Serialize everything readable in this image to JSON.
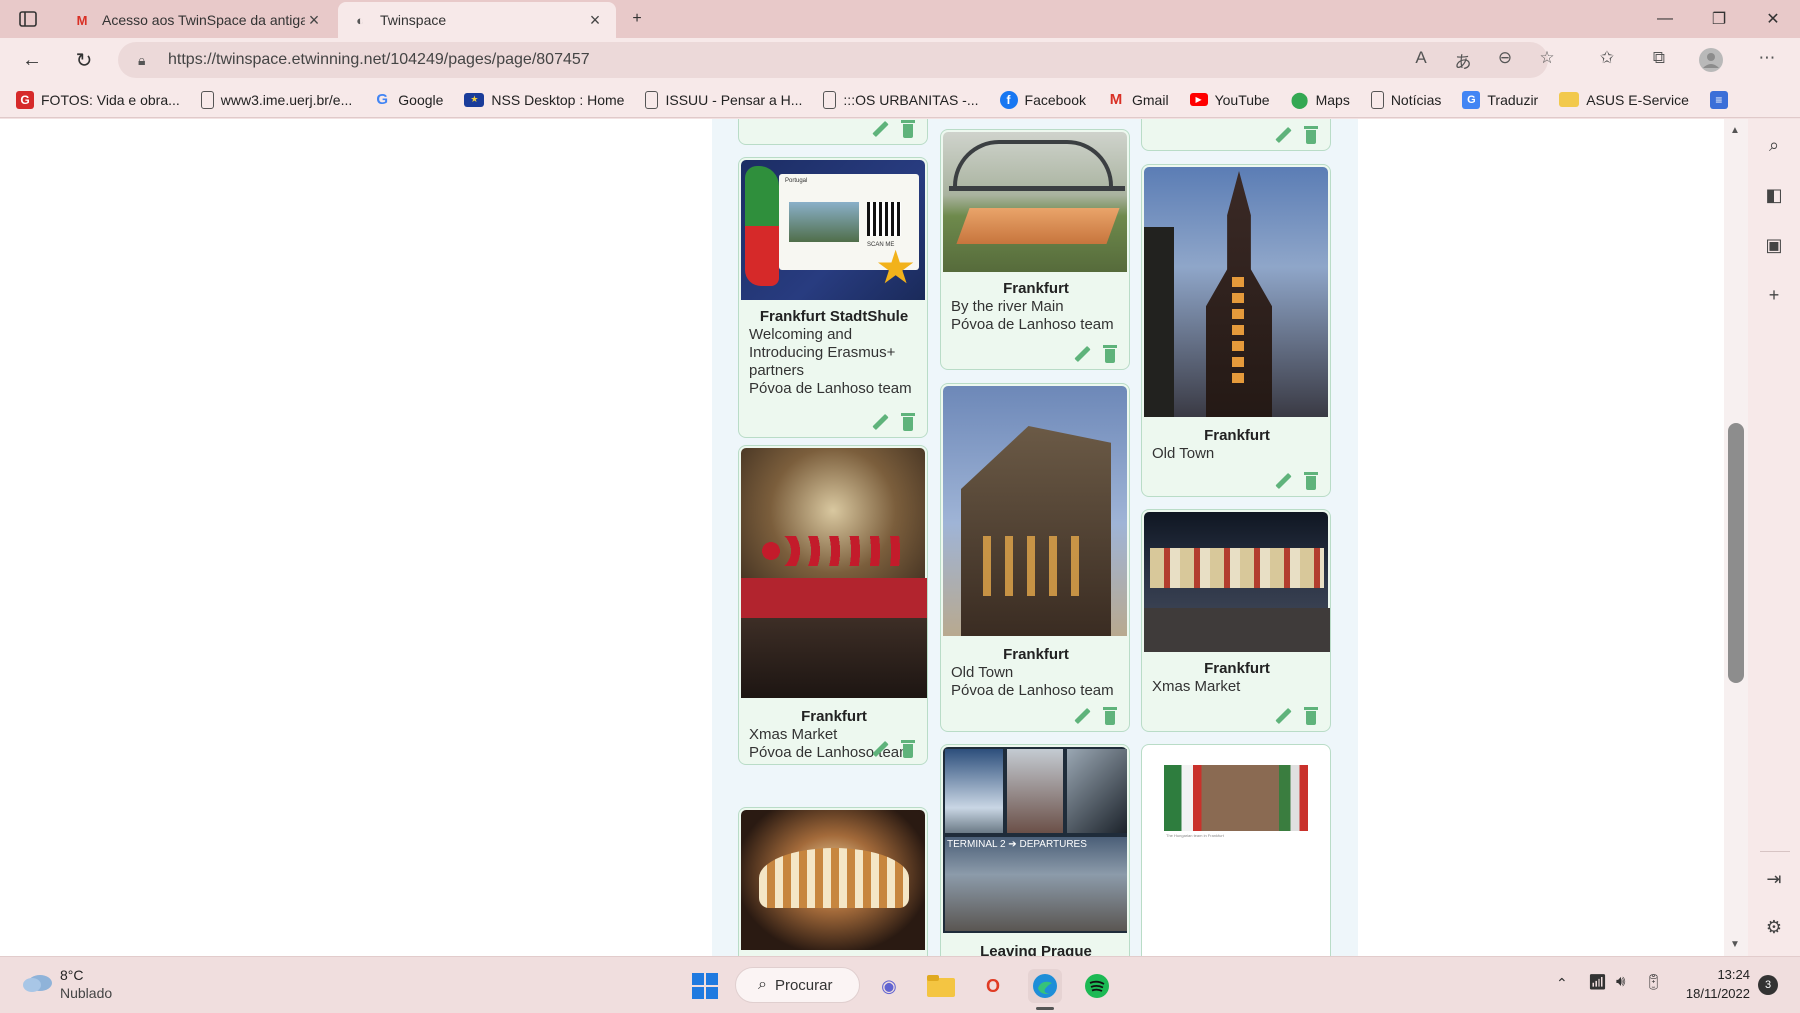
{
  "browser": {
    "tabs": [
      {
        "title": "Acesso aos TwinSpace da antiga",
        "favicon": "gmail-icon"
      },
      {
        "title": "Twinspace",
        "favicon": "twinspace-icon"
      }
    ],
    "url": "https://twinspace.etwinning.net/104249/pages/page/807457"
  },
  "bookmarks": [
    {
      "label": "FOTOS: Vida e obra...",
      "icon": "G"
    },
    {
      "label": "www3.ime.uerj.br/e...",
      "icon": "page"
    },
    {
      "label": "Google",
      "icon": "G"
    },
    {
      "label": "NSS Desktop : Home",
      "icon": "eu"
    },
    {
      "label": "ISSUU - Pensar a H...",
      "icon": "page"
    },
    {
      "label": ":::OS URBANITAS -...",
      "icon": "page"
    },
    {
      "label": "Facebook",
      "icon": "f"
    },
    {
      "label": "Gmail",
      "icon": "M"
    },
    {
      "label": "YouTube",
      "icon": "yt"
    },
    {
      "label": "Maps",
      "icon": "pin"
    },
    {
      "label": "Notícias",
      "icon": "page"
    },
    {
      "label": "Traduzir",
      "icon": "T"
    },
    {
      "label": "ASUS E-Service",
      "icon": "folder"
    }
  ],
  "gallery": {
    "col1": [
      {
        "title": "",
        "lines": []
      },
      {
        "title": "Frankfurt StadtShule",
        "lines": [
          "Welcoming and",
          "Introducing Erasmus+",
          "partners",
          "Póvoa de Lanhoso team"
        ]
      },
      {
        "title": "Frankfurt",
        "lines": [
          "Xmas Market",
          "Póvoa de Lanhoso team"
        ]
      },
      {
        "title": "",
        "lines": []
      }
    ],
    "col2": [
      {
        "title": "Frankfurt",
        "lines": [
          "By the river Main",
          "Póvoa de Lanhoso team"
        ]
      },
      {
        "title": "Frankfurt",
        "lines": [
          "Old Town",
          "Póvoa de Lanhoso team"
        ]
      },
      {
        "title": "Leaving Prague",
        "lines": []
      }
    ],
    "col3": [
      {
        "title": "",
        "lines": []
      },
      {
        "title": "Frankfurt",
        "lines": [
          "Old Town"
        ]
      },
      {
        "title": "Frankfurt",
        "lines": [
          "Xmas Market"
        ]
      },
      {
        "title": "",
        "lines": []
      }
    ],
    "poster_caption": "The Hungarian team in Frankfurt",
    "photo_texts": {
      "sign": "TERMINAL 2 ➔ DEPARTURES",
      "sign_label": "Portugal",
      "scan": "SCAN ME"
    }
  },
  "taskbar": {
    "weather_temp": "8°C",
    "weather_desc": "Nublado",
    "search_label": "Procurar",
    "time": "13:24",
    "date": "18/11/2022",
    "notifications": "3"
  }
}
